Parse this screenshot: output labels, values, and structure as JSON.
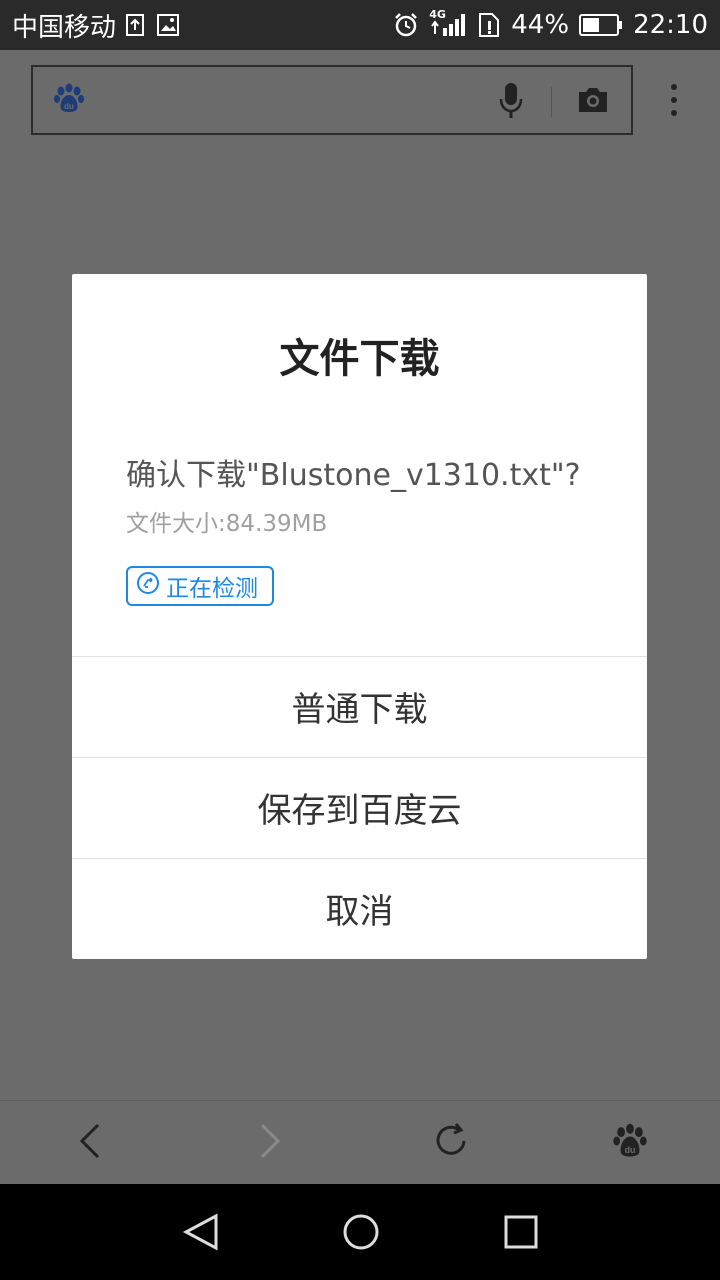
{
  "status_bar": {
    "carrier": "中国移动",
    "network": "4G",
    "battery_percent": "44%",
    "time": "22:10"
  },
  "dialog": {
    "title": "文件下载",
    "message": "确认下载\"Blustone_v1310.txt\"?",
    "file_size": "文件大小:84.39MB",
    "status_badge": "正在检测",
    "options": [
      "普通下载",
      "保存到百度云",
      "取消"
    ]
  },
  "icons": {
    "search_logo": "baidu-paw-icon",
    "voice": "microphone-icon",
    "camera": "camera-icon",
    "menu": "more-vert-icon",
    "toolbar": [
      "back-icon",
      "forward-icon",
      "refresh-icon",
      "baidu-paw-icon"
    ],
    "nav": [
      "nav-back-icon",
      "nav-home-icon",
      "nav-recents-icon"
    ]
  }
}
